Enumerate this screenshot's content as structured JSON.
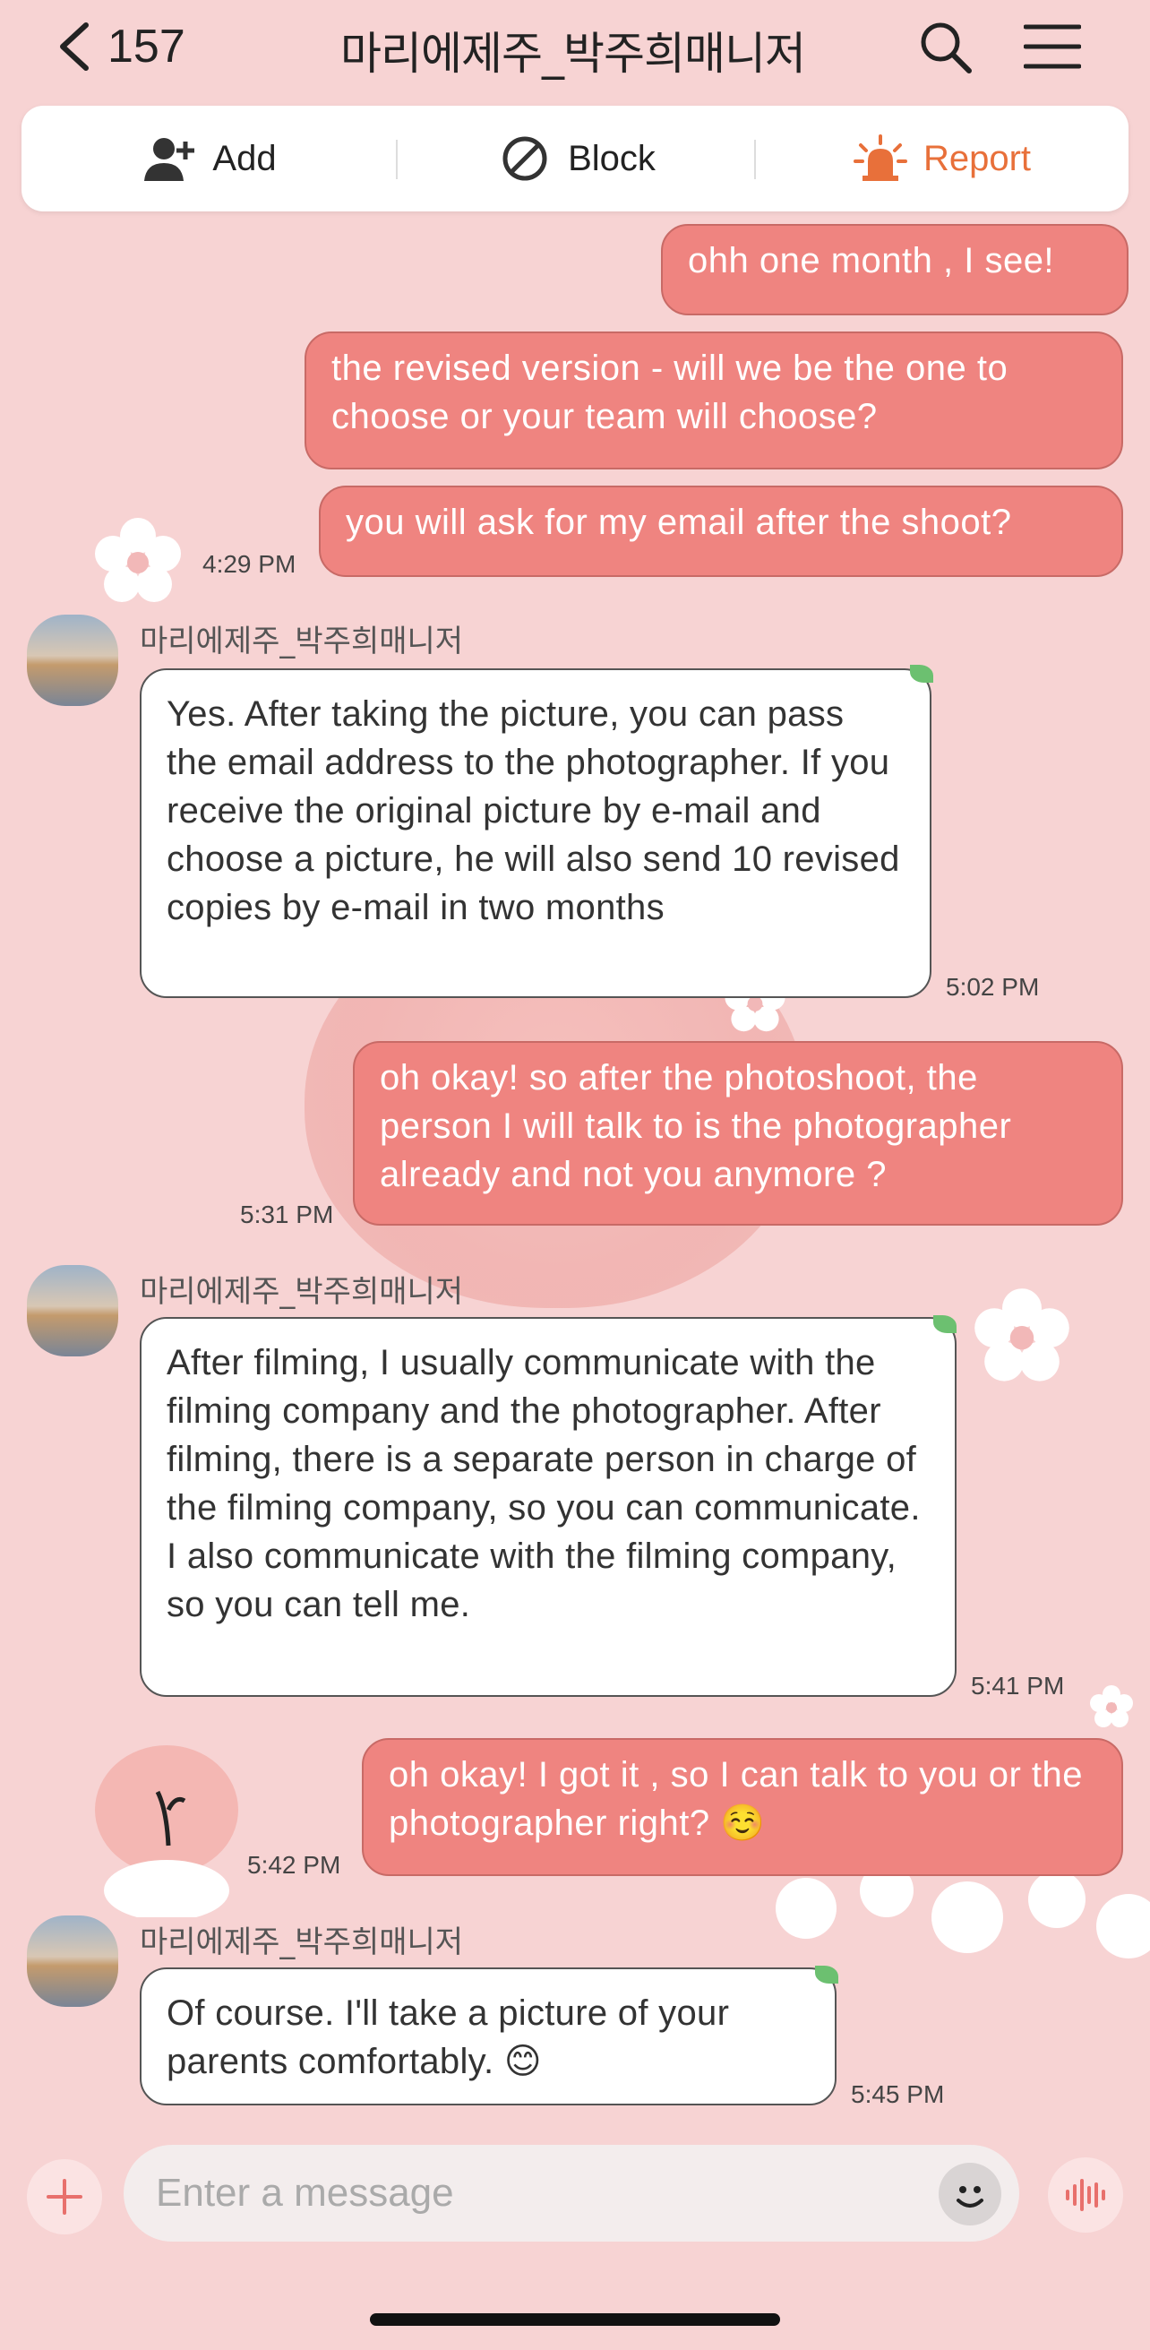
{
  "header": {
    "count": "157",
    "title": "마리에제주_박주희매니저"
  },
  "actions": {
    "add": "Add",
    "block": "Block",
    "report": "Report"
  },
  "colors": {
    "background": "#f7d3d3",
    "my_bubble": "#ef8480",
    "report": "#e8703a"
  },
  "messages": [
    {
      "type": "me",
      "text": "ohh one month , I see!",
      "time": ""
    },
    {
      "type": "me",
      "text": "the revised version - will we be the one to choose or your team will choose?",
      "time": ""
    },
    {
      "type": "me",
      "text": "you will ask for my email after the shoot?",
      "time": "4:29 PM"
    },
    {
      "type": "them",
      "sender": "마리에제주_박주희매니저",
      "text": "Yes. After taking the picture, you can pass the email address to the photographer. If you receive the original picture by e-mail and choose a picture, he will also send 10 revised copies by e-mail in two months",
      "time": "5:02 PM"
    },
    {
      "type": "me",
      "text": "oh okay! so after the photoshoot, the person I will talk to is the photographer already and not you anymore  ?",
      "time": "5:31 PM"
    },
    {
      "type": "them",
      "sender": "마리에제주_박주희매니저",
      "text": "After filming, I usually communicate with the filming company and the photographer. After filming, there is a separate person in charge of the filming company, so you can communicate. I also communicate with the filming company, so you can tell me.",
      "time": "5:41 PM"
    },
    {
      "type": "me",
      "text": "oh okay! I got it , so I can talk to you or the photographer right? ☺️",
      "time": "5:42 PM"
    },
    {
      "type": "them",
      "sender": "마리에제주_박주희매니저",
      "text": "Of course. I'll take a picture of your parents comfortably. 😊",
      "time": "5:45 PM"
    }
  ],
  "input": {
    "placeholder": "Enter a message"
  }
}
